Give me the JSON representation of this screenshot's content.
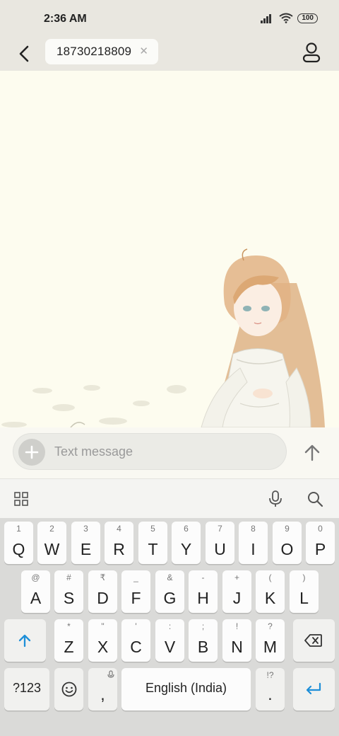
{
  "status_bar": {
    "time": "2:36 AM",
    "battery": "100"
  },
  "header": {
    "recipient": "18730218809"
  },
  "composer": {
    "placeholder": "Text message"
  },
  "keyboard": {
    "row1": [
      {
        "hint": "1",
        "key": "Q"
      },
      {
        "hint": "2",
        "key": "W"
      },
      {
        "hint": "3",
        "key": "E"
      },
      {
        "hint": "4",
        "key": "R"
      },
      {
        "hint": "5",
        "key": "T"
      },
      {
        "hint": "6",
        "key": "Y"
      },
      {
        "hint": "7",
        "key": "U"
      },
      {
        "hint": "8",
        "key": "I"
      },
      {
        "hint": "9",
        "key": "O"
      },
      {
        "hint": "0",
        "key": "P"
      }
    ],
    "row2": [
      {
        "hint": "@",
        "key": "A"
      },
      {
        "hint": "#",
        "key": "S"
      },
      {
        "hint": "₹",
        "key": "D"
      },
      {
        "hint": "_",
        "key": "F"
      },
      {
        "hint": "&",
        "key": "G"
      },
      {
        "hint": "-",
        "key": "H"
      },
      {
        "hint": "+",
        "key": "J"
      },
      {
        "hint": "(",
        "key": "K"
      },
      {
        "hint": ")",
        "key": "L"
      }
    ],
    "row3": [
      {
        "hint": "*",
        "key": "Z"
      },
      {
        "hint": "\"",
        "key": "X"
      },
      {
        "hint": "'",
        "key": "C"
      },
      {
        "hint": ":",
        "key": "V"
      },
      {
        "hint": ";",
        "key": "B"
      },
      {
        "hint": "!",
        "key": "N"
      },
      {
        "hint": "?",
        "key": "M"
      }
    ],
    "symbols_label": "?123",
    "comma": ",",
    "space_label": "English (India)",
    "period_hint": "!?",
    "period": "."
  },
  "colors": {
    "accent": "#1e8fd8",
    "chat_bg": "#fdfcef",
    "keyboard_bg": "#dadad8"
  }
}
